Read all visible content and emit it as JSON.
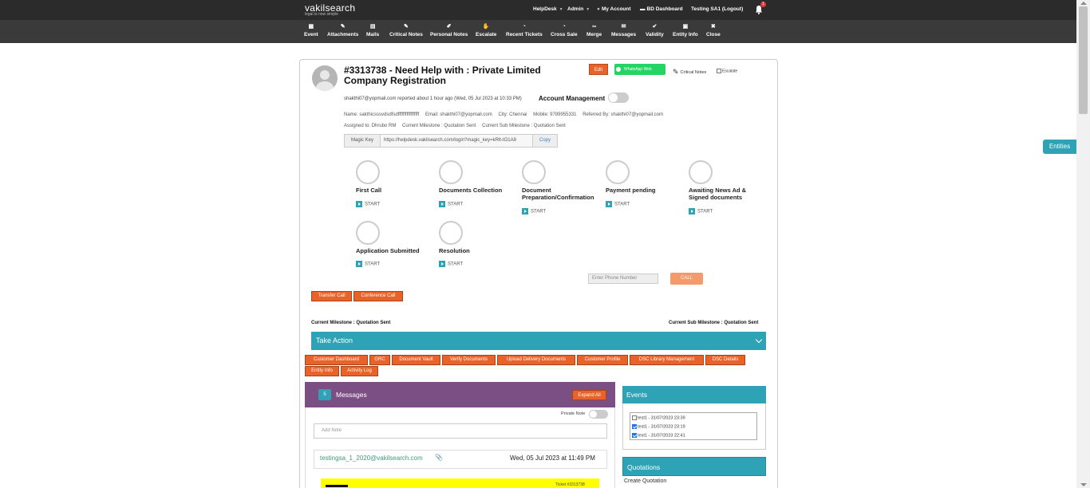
{
  "brand": {
    "name": "vakilsearch",
    "tagline": "legal is now simple"
  },
  "topnav": {
    "helpdesk": "HelpDesk",
    "admin": "Admin",
    "my_account": "My Account",
    "bd_dashboard": "BD Dashboard",
    "user": "Testing SA1 (Logout)",
    "notification_count": "1"
  },
  "toolbar": [
    {
      "label": "Event",
      "icon": "calendar-icon"
    },
    {
      "label": "Attachments",
      "icon": "paperclip-icon"
    },
    {
      "label": "Mails",
      "icon": "mail-icon"
    },
    {
      "label": "Critical Notes",
      "icon": "pencil-icon"
    },
    {
      "label": "Personal Notes",
      "icon": "pin-icon"
    },
    {
      "label": "Escalate",
      "icon": "hand-icon"
    },
    {
      "label": "Recent Tickets",
      "icon": "clock-icon"
    },
    {
      "label": "Cross Sale",
      "icon": "clock-icon"
    },
    {
      "label": "Merge",
      "icon": "link-icon"
    },
    {
      "label": "Messages",
      "icon": "envelope-icon"
    },
    {
      "label": "Validity",
      "icon": "check-icon"
    },
    {
      "label": "Entity Info",
      "icon": "document-icon"
    },
    {
      "label": "Close",
      "icon": "close-icon"
    }
  ],
  "entities_tab": "Entities",
  "ticket": {
    "title": "#3313738 - Need Help with : Private Limited Company Registration",
    "edit": "Edit",
    "whatsapp": "WhatsApp Web",
    "critical_notes": "Critical Notes",
    "escalate": "Escalate",
    "reporter": "shakthi07@yopmail.com reported about 1 hour ago (Wed, 05 Jul 2023 at 10:33 PM)",
    "account_management": "Account Management",
    "name": "Name: sakthicsssvdsdfsdfffffffffffffffff",
    "email": "Email: shakthi07@yopmail.com",
    "city": "City: Chennai",
    "mobile": "Mobile: 9789955331",
    "referred_by": "Referred By: shakthi07@yopmail.com",
    "assigned_to": "Assigned to: Dhrubo RM",
    "current_milestone": "Current Milestone : Quotation Sent",
    "current_sub_milestone": "Current Sub Milestone : Quotation Sent",
    "magic_key_label": "Magic Key",
    "magic_key_value": "https://helpdesk.vakilsearch.com/login?magic_key=kRlt-tO1A8",
    "copy": "Copy"
  },
  "milestones": [
    {
      "name": "First Call",
      "start": "START"
    },
    {
      "name": "Documents Collection",
      "start": "START"
    },
    {
      "name": "Document Preparation/Confirmation",
      "start": "START"
    },
    {
      "name": "Payment pending",
      "start": "START"
    },
    {
      "name": "Awaiting News Ad & Signed documents",
      "start": "START"
    },
    {
      "name": "Application Submitted",
      "start": "START"
    },
    {
      "name": "Resolution",
      "start": "START"
    }
  ],
  "phone_placeholder": "Enter Phone Number",
  "call": "CALL",
  "transfer_call": "Transfer Call",
  "conference_call": "Conference Call",
  "current_milestone_bar": "Current Milestone : Quotation Sent",
  "current_sub_milestone_bar": "Current Sub Milestone : Quotation Sent",
  "take_action": "Take Action",
  "action_buttons": [
    "Customer Dashboard",
    "GRC",
    "Document Vault",
    "Verify Documents",
    "Upload Delivery Documents",
    "Customer Profile",
    "DSC Library Management",
    "DSC Details",
    "Entity Info",
    "Activity Log"
  ],
  "messages": {
    "count": "5",
    "title": "Messages",
    "expand_all": "Expand All",
    "private_note": "Private Note",
    "add_note_placeholder": "Add Note",
    "from": "testingsa_1_2020@vakilsearch.com",
    "date": "Wed, 05 Jul 2023 at 11:49 PM",
    "ticket_ref": "Ticket #3313738"
  },
  "events": {
    "title": "Events",
    "items": [
      {
        "label": "test1 - 31/07/2023 23:39",
        "checked": false
      },
      {
        "label": "test1 - 31/07/2023 23:19",
        "checked": true
      },
      {
        "label": "test1 - 31/07/2023 22:41",
        "checked": true
      }
    ]
  },
  "quotations": {
    "title": "Quotations",
    "create": "Create Quotation"
  }
}
